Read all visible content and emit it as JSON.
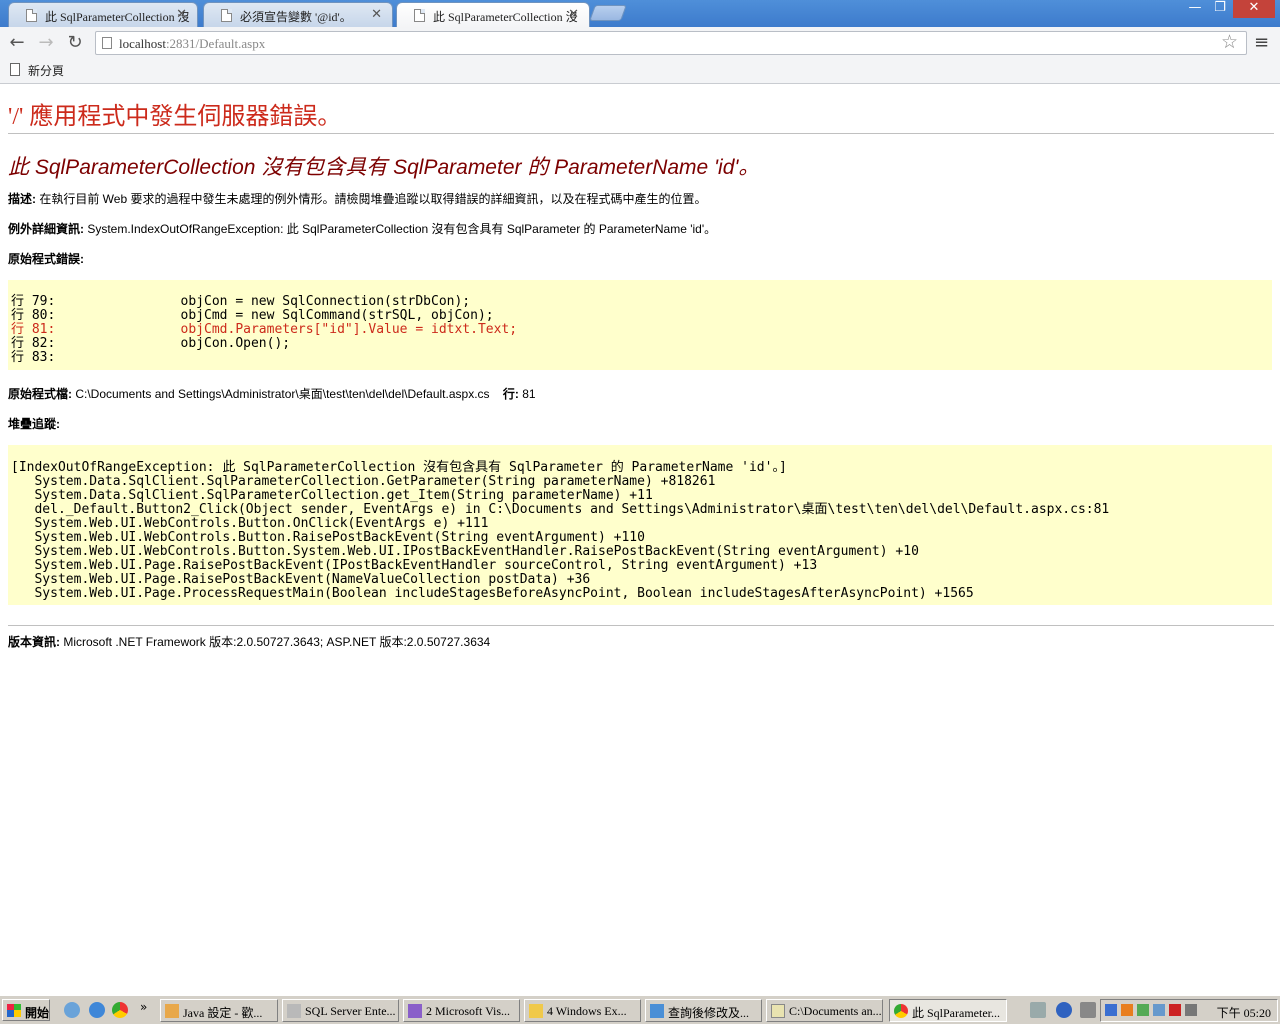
{
  "browser": {
    "tabs": [
      {
        "title": "此 SqlParameterCollection 沒",
        "close": "✕"
      },
      {
        "title": "必須宣告變數 '@id'。",
        "close": "✕"
      },
      {
        "title": "此 SqlParameterCollection 沒",
        "close": "✕"
      }
    ],
    "window_buttons": {
      "minimize": "—",
      "maximize": "❐",
      "close": "✕"
    },
    "nav": {
      "back": "←",
      "forward": "→",
      "reload": "↻"
    },
    "url_host": "localhost",
    "url_rest": ":2831/Default.aspx",
    "star": "☆",
    "menu": "≡",
    "bookmark_label": "新分頁"
  },
  "page": {
    "h1": "'/' 應用程式中發生伺服器錯誤。",
    "h2": "此 SqlParameterCollection 沒有包含具有 SqlParameter 的 ParameterName 'id'。",
    "description_label": "描述:",
    "description_text": " 在執行目前 Web 要求的過程中發生未處理的例外情形。請檢閱堆疊追蹤以取得錯誤的詳細資訊，以及在程式碼中產生的位置。",
    "exception_label": "例外詳細資訊:",
    "exception_text": " System.IndexOutOfRangeException: 此 SqlParameterCollection 沒有包含具有 SqlParameter 的 ParameterName 'id'。",
    "source_error_label": "原始程式錯誤:",
    "source_lines": [
      {
        "text": "行 79:                objCon = new SqlConnection(strDbCon);",
        "error": false
      },
      {
        "text": "行 80:                objCmd = new SqlCommand(strSQL, objCon);",
        "error": false
      },
      {
        "text": "行 81:                objCmd.Parameters[\"id\"].Value = idtxt.Text;",
        "error": true
      },
      {
        "text": "行 82:                objCon.Open();",
        "error": false
      },
      {
        "text": "行 83:",
        "error": false
      }
    ],
    "source_file_label": "原始程式檔:",
    "source_file_path": " C:\\Documents and Settings\\Administrator\\桌面\\test\\ten\\del\\del\\Default.aspx.cs",
    "line_label": "行:",
    "line_number": " 81",
    "stack_trace_label": "堆疊追蹤:",
    "stack_lines": [
      "[IndexOutOfRangeException: 此 SqlParameterCollection 沒有包含具有 SqlParameter 的 ParameterName 'id'。]",
      "   System.Data.SqlClient.SqlParameterCollection.GetParameter(String parameterName) +818261",
      "   System.Data.SqlClient.SqlParameterCollection.get_Item(String parameterName) +11",
      "   del._Default.Button2_Click(Object sender, EventArgs e) in C:\\Documents and Settings\\Administrator\\桌面\\test\\ten\\del\\del\\Default.aspx.cs:81",
      "   System.Web.UI.WebControls.Button.OnClick(EventArgs e) +111",
      "   System.Web.UI.WebControls.Button.RaisePostBackEvent(String eventArgument) +110",
      "   System.Web.UI.WebControls.Button.System.Web.UI.IPostBackEventHandler.RaisePostBackEvent(String eventArgument) +10",
      "   System.Web.UI.Page.RaisePostBackEvent(IPostBackEventHandler sourceControl, String eventArgument) +13",
      "   System.Web.UI.Page.RaisePostBackEvent(NameValueCollection postData) +36",
      "   System.Web.UI.Page.ProcessRequestMain(Boolean includeStagesBeforeAsyncPoint, Boolean includeStagesAfterAsyncPoint) +1565"
    ],
    "version_label": "版本資訊:",
    "version_text": " Microsoft .NET Framework 版本:2.0.50727.3643; ASP.NET 版本:2.0.50727.3634"
  },
  "taskbar": {
    "start_label": "開始",
    "quicklaunch_more": "»",
    "tasks": [
      {
        "label": "Java 設定 - 歡..."
      },
      {
        "label": "SQL Server Ente..."
      },
      {
        "label": "2 Microsoft Vis..."
      },
      {
        "label": "4 Windows Ex..."
      },
      {
        "label": "查詢後修改及..."
      },
      {
        "label": "C:\\Documents an..."
      },
      {
        "label": "此 SqlParameter..."
      }
    ],
    "clock": "下午 05:20"
  },
  "colors": {
    "error_red": "#cc2a1b",
    "heading_darkred": "#7c0000",
    "code_bg": "#ffffcc",
    "titlebar_blue": "#3d7bcc"
  }
}
